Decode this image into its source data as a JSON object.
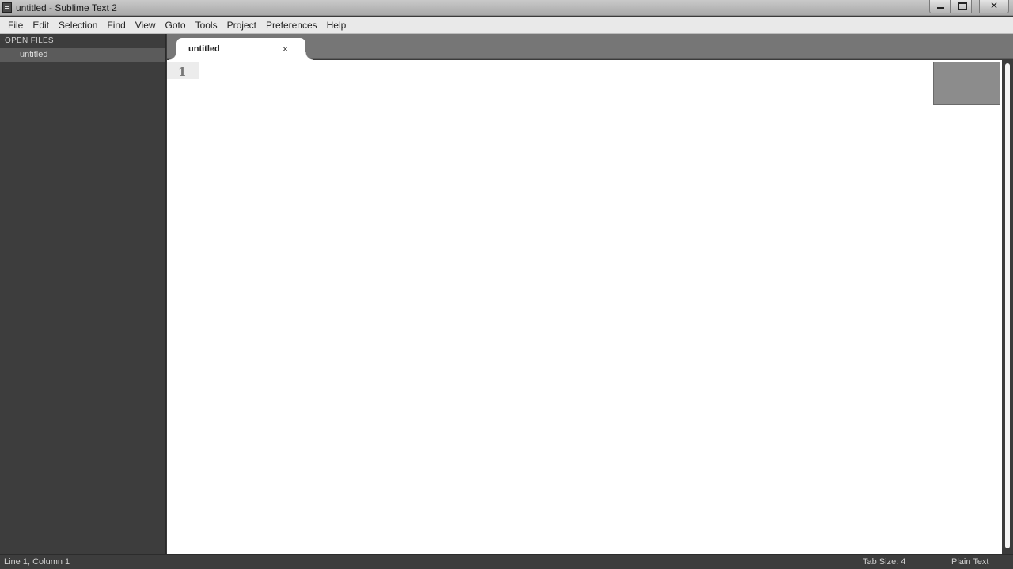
{
  "window": {
    "title": "untitled - Sublime Text 2"
  },
  "menu": {
    "items": [
      "File",
      "Edit",
      "Selection",
      "Find",
      "View",
      "Goto",
      "Tools",
      "Project",
      "Preferences",
      "Help"
    ]
  },
  "sidebar": {
    "header": "OPEN FILES",
    "files": [
      "untitled"
    ]
  },
  "tabs": [
    {
      "label": "untitled",
      "close": "×"
    }
  ],
  "editor": {
    "lines": [
      "1"
    ]
  },
  "statusbar": {
    "position": "Line 1, Column 1",
    "tab_size": "Tab Size: 4",
    "syntax": "Plain Text"
  },
  "colors": {
    "sidebar_bg": "#3d3d3d",
    "tabbar_bg": "#767676",
    "editor_bg": "#ffffff"
  }
}
